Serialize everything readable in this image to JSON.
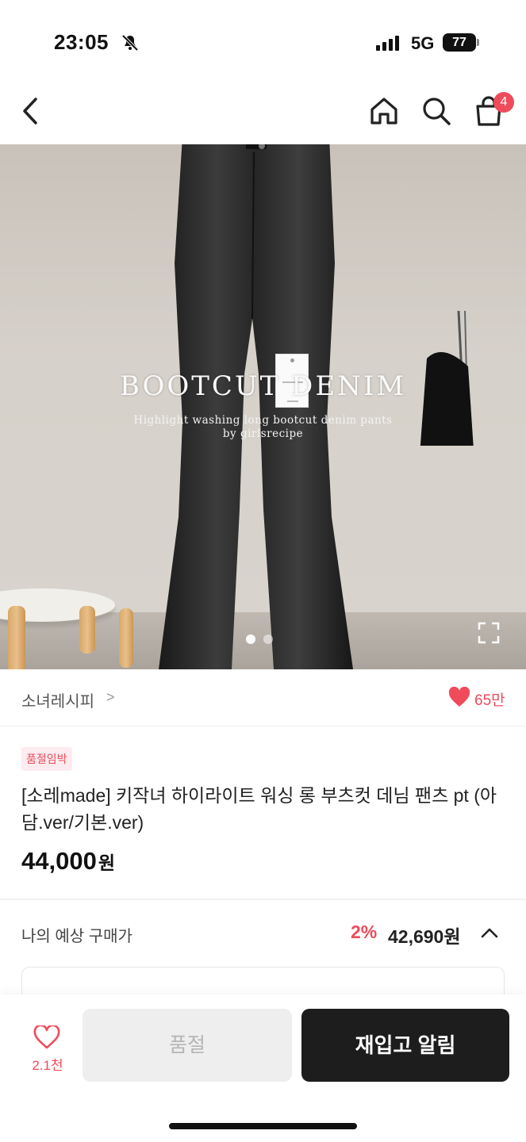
{
  "status_bar": {
    "time": "23:05",
    "network": "5G",
    "battery": "77",
    "icons": [
      "bell-slash-icon",
      "signal-icon"
    ]
  },
  "nav": {
    "icons": [
      "back-icon",
      "home-icon",
      "search-icon",
      "cart-icon"
    ],
    "cart_badge": "4"
  },
  "hero": {
    "title": "BOOTCUT DENIM",
    "subtitle_line1": "Highlight washing long bootcut denim pants",
    "subtitle_line2": "by girlsrecipe",
    "slides_total": 2,
    "slide_active": 1
  },
  "store": {
    "name": "소녀레시피",
    "chevron": ">",
    "likes": "65만"
  },
  "product": {
    "badge": "품절임박",
    "title": "[소레made] 키작녀 하이라이트 워싱 롱 부츠컷 데님 팬츠 pt (아담.ver/기본.ver)",
    "price": "44,000",
    "price_unit": "원"
  },
  "estimate": {
    "label": "나의 예상 구매가",
    "discount": "2%",
    "price": "42,690원"
  },
  "bottom_bar": {
    "wish_count": "2.1천",
    "soldout_label": "품절",
    "restock_label": "재입고 알림"
  },
  "colors": {
    "accent": "#ef4b5b",
    "dark_button": "#1d1d1d",
    "disabled_button": "#eeeeee"
  }
}
